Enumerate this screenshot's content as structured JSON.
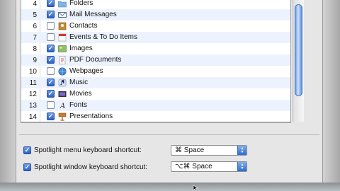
{
  "list": {
    "rows": [
      {
        "num": "4",
        "label": "Folders",
        "checked": true,
        "icon": "folder-icon"
      },
      {
        "num": "5",
        "label": "Mail Messages",
        "checked": true,
        "icon": "mail-icon"
      },
      {
        "num": "6",
        "label": "Contacts",
        "checked": false,
        "icon": "contacts-icon"
      },
      {
        "num": "7",
        "label": "Events & To Do Items",
        "checked": false,
        "icon": "calendar-icon"
      },
      {
        "num": "8",
        "label": "Images",
        "checked": true,
        "icon": "image-icon"
      },
      {
        "num": "9",
        "label": "PDF Documents",
        "checked": true,
        "icon": "pdf-icon"
      },
      {
        "num": "10",
        "label": "Webpages",
        "checked": false,
        "icon": "globe-icon"
      },
      {
        "num": "11",
        "label": "Music",
        "checked": true,
        "icon": "music-icon"
      },
      {
        "num": "12",
        "label": "Movies",
        "checked": true,
        "icon": "movie-icon"
      },
      {
        "num": "13",
        "label": "Fonts",
        "checked": false,
        "icon": "font-icon"
      },
      {
        "num": "14",
        "label": "Presentations",
        "checked": true,
        "icon": "presentation-icon"
      }
    ]
  },
  "shortcuts": {
    "menu_label": "Spotlight menu keyboard shortcut:",
    "menu_value": "⌘ Space",
    "window_label": "Spotlight window keyboard shortcut:",
    "window_value": "⌥⌘ Space"
  },
  "colors": {
    "accent": "#2b62c9",
    "row_alt": "#edf3fe"
  }
}
